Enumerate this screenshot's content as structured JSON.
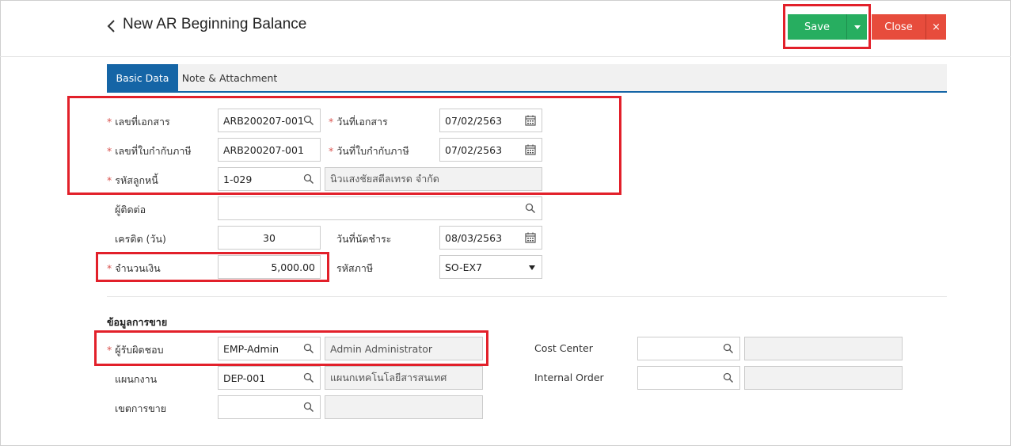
{
  "header": {
    "title": "New AR Beginning Balance",
    "save_label": "Save",
    "close_label": "Close",
    "close_x": "×"
  },
  "tabs": [
    {
      "label": "Basic Data",
      "active": true
    },
    {
      "label": "Note & Attachment",
      "active": false
    }
  ],
  "form": {
    "doc_no": {
      "label": "เลขที่เอกสาร",
      "value": "ARB200207-001",
      "required": true
    },
    "doc_date": {
      "label": "วันที่เอกสาร",
      "value": "07/02/2563",
      "required": true
    },
    "tax_inv_no": {
      "label": "เลขที่ใบกำกับภาษี",
      "value": "ARB200207-001",
      "required": true
    },
    "tax_inv_date": {
      "label": "วันที่ใบกำกับภาษี",
      "value": "07/02/2563",
      "required": true
    },
    "debtor_code": {
      "label": "รหัสลูกหนี้",
      "value": "1-029",
      "name": "นิวแสงชัยสตีลเทรด จำกัด",
      "required": true
    },
    "contact": {
      "label": "ผู้ติดต่อ",
      "value": ""
    },
    "credit_days": {
      "label": "เครดิต (วัน)",
      "value": "30"
    },
    "due_date": {
      "label": "วันที่นัดชำระ",
      "value": "08/03/2563"
    },
    "amount": {
      "label": "จำนวนเงิน",
      "value": "5,000.00",
      "required": true
    },
    "tax_code": {
      "label": "รหัสภาษี",
      "value": "SO-EX7"
    }
  },
  "sales": {
    "section_title": "ข้อมูลการขาย",
    "responsible": {
      "label": "ผู้รับผิดชอบ",
      "value": "EMP-Admin",
      "name": "Admin Administrator",
      "required": true
    },
    "department": {
      "label": "แผนกงาน",
      "value": "DEP-001",
      "name": "แผนกเทคโนโลยีสารสนเทศ"
    },
    "sales_area": {
      "label": "เขตการขาย",
      "value": "",
      "name": ""
    },
    "cost_center": {
      "label": "Cost Center",
      "value": "",
      "name": ""
    },
    "internal_order": {
      "label": "Internal Order",
      "value": "",
      "name": ""
    }
  },
  "colors": {
    "save": "#27ae60",
    "close": "#e74c3c",
    "tab_active": "#1565a6",
    "highlight": "#e2202a",
    "required": "#d9534f"
  }
}
